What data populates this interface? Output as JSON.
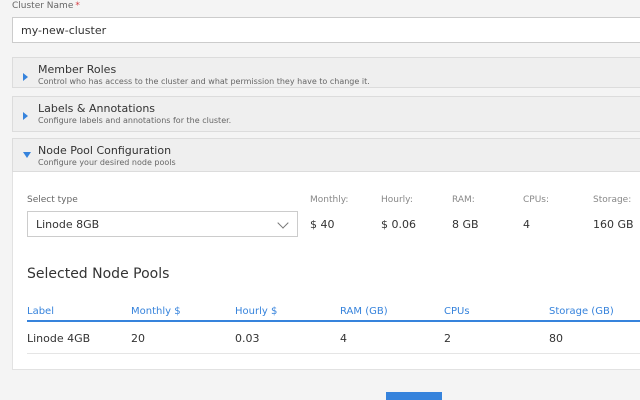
{
  "cluster_name": {
    "label": "Cluster Name",
    "required_mark": "*",
    "value": "my-new-cluster"
  },
  "panels": [
    {
      "title": "Member Roles",
      "description": "Control who has access to the cluster and what permission they have to change it.",
      "expanded": false
    },
    {
      "title": "Labels & Annotations",
      "description": "Configure labels and annotations for the cluster.",
      "expanded": false
    },
    {
      "title": "Node Pool Configuration",
      "description": "Configure your desired node pools",
      "expanded": true
    }
  ],
  "node_pool": {
    "select_label": "Select type",
    "selected_type": "Linode 8GB",
    "specs": {
      "headers": [
        "Monthly:",
        "Hourly:",
        "RAM:",
        "CPUs:",
        "Storage:"
      ],
      "values": [
        "$ 40",
        "$ 0.06",
        "8 GB",
        "4",
        "160 GB"
      ]
    },
    "selected_title": "Selected Node Pools",
    "table": {
      "columns": [
        "Label",
        "Monthly $",
        "Hourly $",
        "RAM (GB)",
        "CPUs",
        "Storage (GB)"
      ],
      "rows": [
        [
          "Linode 4GB",
          "20",
          "0.03",
          "4",
          "2",
          "80"
        ]
      ]
    }
  },
  "colors": {
    "accent": "#3683dc",
    "required": "#d63c42"
  }
}
